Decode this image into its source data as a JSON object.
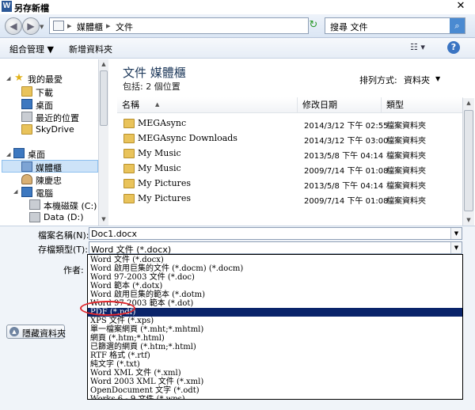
{
  "window": {
    "app_icon": "W",
    "title": "另存新檔",
    "close": "✕"
  },
  "address": {
    "back": "◀",
    "forward": "▶",
    "sep1": "▸",
    "crumb1": "媒體櫃",
    "sep2": "▸",
    "crumb2": "文件",
    "drop": "▼",
    "refresh": "↻",
    "search_placeholder": "搜尋 文件",
    "search_icon": "search-icon"
  },
  "toolbar": {
    "organize": "組合管理 ▼",
    "new_folder": "新增資料夾",
    "view_icon": "☷ ▾",
    "help": "?"
  },
  "nav": {
    "items": [
      {
        "label": "我的最愛",
        "icon": "star-icon"
      },
      {
        "label": "下載",
        "icon": "download-folder-icon"
      },
      {
        "label": "桌面",
        "icon": "desktop-icon"
      },
      {
        "label": "最近的位置",
        "icon": "recent-places-icon"
      },
      {
        "label": "SkyDrive",
        "icon": "skydrive-folder-icon"
      },
      {
        "label": "桌面",
        "icon": "desktop-icon"
      },
      {
        "label": "媒體櫃",
        "icon": "library-icon"
      },
      {
        "label": "陳慶忠",
        "icon": "user-icon"
      },
      {
        "label": "電腦",
        "icon": "computer-icon"
      },
      {
        "label": "本機磁碟 (C:)",
        "icon": "drive-icon"
      },
      {
        "label": "Data (D:)",
        "icon": "drive-icon"
      }
    ]
  },
  "content": {
    "title": "文件 媒體櫃",
    "subtitle": "包括: 2 個位置",
    "arrange_label": "排列方式:",
    "arrange_value": "資料夾",
    "arrange_drop": "▼",
    "columns": [
      "名稱",
      "修改日期",
      "類型"
    ],
    "sort_arrow": "▲",
    "rows": [
      {
        "name": "MEGAsync",
        "date": "2014/3/12 下午 02:55",
        "type": "檔案資料夾",
        "icon": "folder-icon"
      },
      {
        "name": "MEGAsync Downloads",
        "date": "2014/3/12 下午 03:00",
        "type": "檔案資料夾",
        "icon": "folder-icon"
      },
      {
        "name": "My Music",
        "date": "2013/5/8 下午 04:14",
        "type": "檔案資料夾",
        "icon": "music-folder-icon"
      },
      {
        "name": "My Music",
        "date": "2009/7/14 下午 01:08",
        "type": "檔案資料夾",
        "icon": "locked-folder-icon"
      },
      {
        "name": "My Pictures",
        "date": "2013/5/8 下午 04:14",
        "type": "檔案資料夾",
        "icon": "pictures-folder-icon"
      },
      {
        "name": "My Pictures",
        "date": "2009/7/14 下午 01:08",
        "type": "檔案資料夾",
        "icon": "locked-folder-icon"
      }
    ]
  },
  "form": {
    "filename_label": "檔案名稱(N):",
    "filename_value": "Doc1.docx",
    "filetype_label": "存檔類型(T):",
    "filetype_value": "Word 文件 (*.docx)",
    "author_label": "作者:",
    "hide_folders": "隱藏資料夾",
    "drop": "▼"
  },
  "dropdown": {
    "selected_index": 5,
    "options": [
      "Word 文件 (*.docx)",
      "Word 啟用巨集的文件 (*.docm) (*.docm)",
      "Word 97-2003 文件 (*.doc)",
      "Word 範本 (*.dotx)",
      "Word 啟用巨集的範本 (*.dotm)",
      "Word 97-2003 範本 (*.dot)",
      "PDF (*.pdf)",
      "XPS 文件 (*.xps)",
      "單一檔案網頁 (*.mht;*.mhtml)",
      "網頁 (*.htm;*.html)",
      "已篩選的網頁 (*.htm;*.html)",
      "RTF 格式 (*.rtf)",
      "純文字 (*.txt)",
      "Word XML 文件 (*.xml)",
      "Word 2003 XML 文件 (*.xml)",
      "OpenDocument 文字 (*.odt)",
      "Works 6 - 9 文件 (*.wps)"
    ]
  },
  "colors": {
    "selection": "#0a246a",
    "highlight_circle": "#e0262b",
    "library_title": "#1e395b"
  }
}
